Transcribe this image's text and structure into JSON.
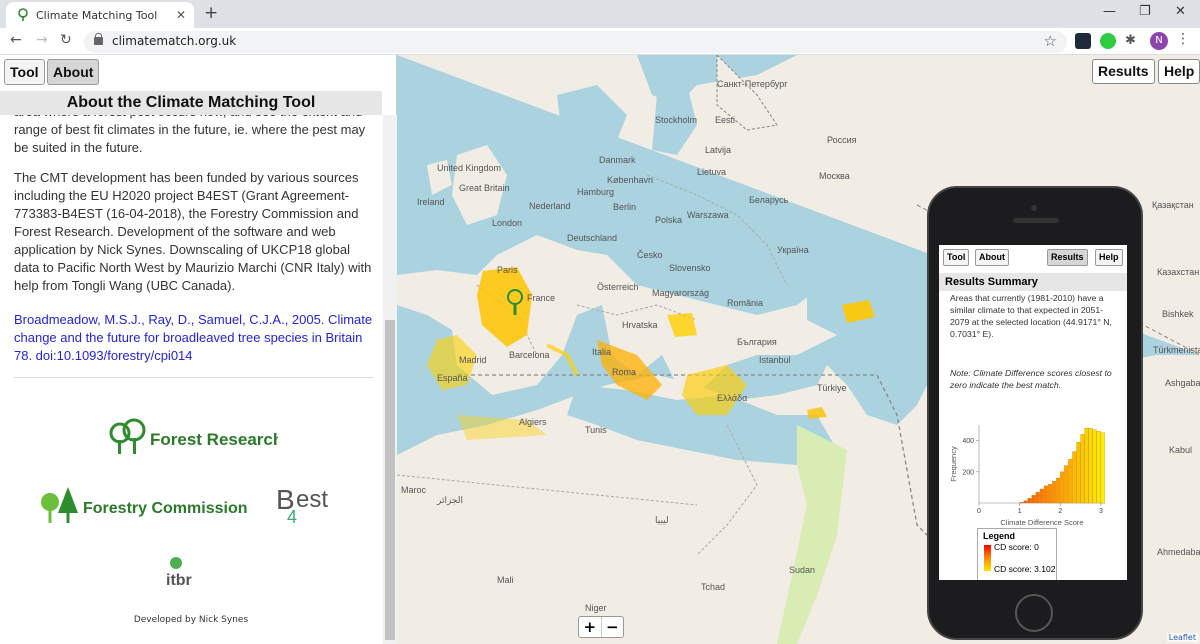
{
  "browser": {
    "tab_title": "Climate Matching Tool",
    "new_tab": "+",
    "url": "climatematch.org.uk",
    "profile_initial": "N",
    "window_controls": [
      "—",
      "❐",
      "✕"
    ]
  },
  "sidebar": {
    "tool_label": "Tool",
    "about_label": "About",
    "heading": "About the Climate Matching Tool",
    "cut_paragraph": "area where a forest pest occurs now, and see the extent and range of best fit climates in the future, ie. where the pest may be suited in the future.",
    "funding_paragraph": "The CMT development has been funded by various sources including the EU H2020 project B4EST (Grant Agreement-773383-B4EST (16-04-2018), the Forestry Commission and Forest Research. Development of the software and web application by Nick Synes. Downscaling of UKCP18 global data to Pacific North West by Maurizio Marchi (CNR Italy) with help from Tongli Wang (UBC Canada).",
    "citation": "Broadmeadow, M.S.J., Ray, D., Samuel, C.J.A., 2005. Climate change and the future for broadleaved tree species in Britain 78. doi:10.1093/forestry/cpi014",
    "logos": {
      "forest_research": "Forest Research",
      "forestry_commission": "Forestry Commission",
      "b4est": "B4EST",
      "itbr": "itbr"
    },
    "developed_by": "Developed by Nick Synes"
  },
  "map": {
    "results_label": "Results",
    "help_label": "Help",
    "zoom_in": "+",
    "zoom_out": "−",
    "attribution": "Leaflet",
    "place_labels": [
      {
        "text": "Санкт-Петербург"
      },
      {
        "text": "Stockholm"
      },
      {
        "text": "Eesti"
      },
      {
        "text": "Latvija"
      },
      {
        "text": "Lietuva"
      },
      {
        "text": "Danmark"
      },
      {
        "text": "København"
      },
      {
        "text": "Россия"
      },
      {
        "text": "Москва"
      },
      {
        "text": "Ireland"
      },
      {
        "text": "United Kingdom"
      },
      {
        "text": "Great Britain"
      },
      {
        "text": "London"
      },
      {
        "text": "Nederland"
      },
      {
        "text": "Hamburg"
      },
      {
        "text": "Berlin"
      },
      {
        "text": "Polska"
      },
      {
        "text": "Warszawa"
      },
      {
        "text": "Беларусь"
      },
      {
        "text": "Україна"
      },
      {
        "text": "Deutschland"
      },
      {
        "text": "Paris"
      },
      {
        "text": "Česko"
      },
      {
        "text": "Slovensko"
      },
      {
        "text": "Magyarország"
      },
      {
        "text": "France"
      },
      {
        "text": "Österreich"
      },
      {
        "text": "România"
      },
      {
        "text": "Hrvatska"
      },
      {
        "text": "Italia"
      },
      {
        "text": "Roma"
      },
      {
        "text": "България"
      },
      {
        "text": "Barcelona"
      },
      {
        "text": "España"
      },
      {
        "text": "Madrid"
      },
      {
        "text": "Istanbul"
      },
      {
        "text": "Türkiye"
      },
      {
        "text": "Ελλάδα"
      },
      {
        "text": "Algiers"
      },
      {
        "text": "Tunis"
      },
      {
        "text": "الجزائر"
      },
      {
        "text": "ليبيا"
      },
      {
        "text": "Maroc"
      },
      {
        "text": "Niger"
      },
      {
        "text": "Tchad"
      },
      {
        "text": "Mali"
      },
      {
        "text": "Қазақстан"
      },
      {
        "text": "Казахстан"
      },
      {
        "text": "Ashgabat"
      },
      {
        "text": "Türkmenistan"
      },
      {
        "text": "Kabul"
      },
      {
        "text": "Ahmedabad"
      },
      {
        "text": "Sudan"
      },
      {
        "text": "Bishkek"
      }
    ]
  },
  "phone": {
    "tool_label": "Tool",
    "about_label": "About",
    "results_label": "Results",
    "help_label": "Help",
    "heading": "Results Summary",
    "summary": "Areas that currently (1981-2010) have a similar climate to that expected in 2051-2079 at the selected location (44.9171° N, 0.7031° E).",
    "note": "Note: Climate Difference scores closest to zero indicate the best match.",
    "legend_title": "Legend",
    "legend_min": "CD score: 0",
    "legend_max": "CD score: 3.102"
  },
  "chart_data": {
    "type": "bar",
    "xlabel": "Climate Difference Score",
    "ylabel": "Frequency",
    "xlim": [
      0,
      3.1
    ],
    "ylim": [
      0,
      500
    ],
    "xticks": [
      "0",
      "1",
      "2",
      "3"
    ],
    "yticks": [
      "200",
      "400"
    ],
    "bins": [
      1.0,
      1.1,
      1.2,
      1.3,
      1.4,
      1.5,
      1.6,
      1.7,
      1.8,
      1.9,
      2.0,
      2.1,
      2.2,
      2.3,
      2.4,
      2.5,
      2.6,
      2.7,
      2.8,
      2.9,
      3.0,
      3.1
    ],
    "values": [
      5,
      15,
      30,
      50,
      70,
      90,
      110,
      120,
      140,
      160,
      200,
      240,
      280,
      330,
      390,
      440,
      480,
      480,
      470,
      460,
      450,
      0
    ]
  }
}
